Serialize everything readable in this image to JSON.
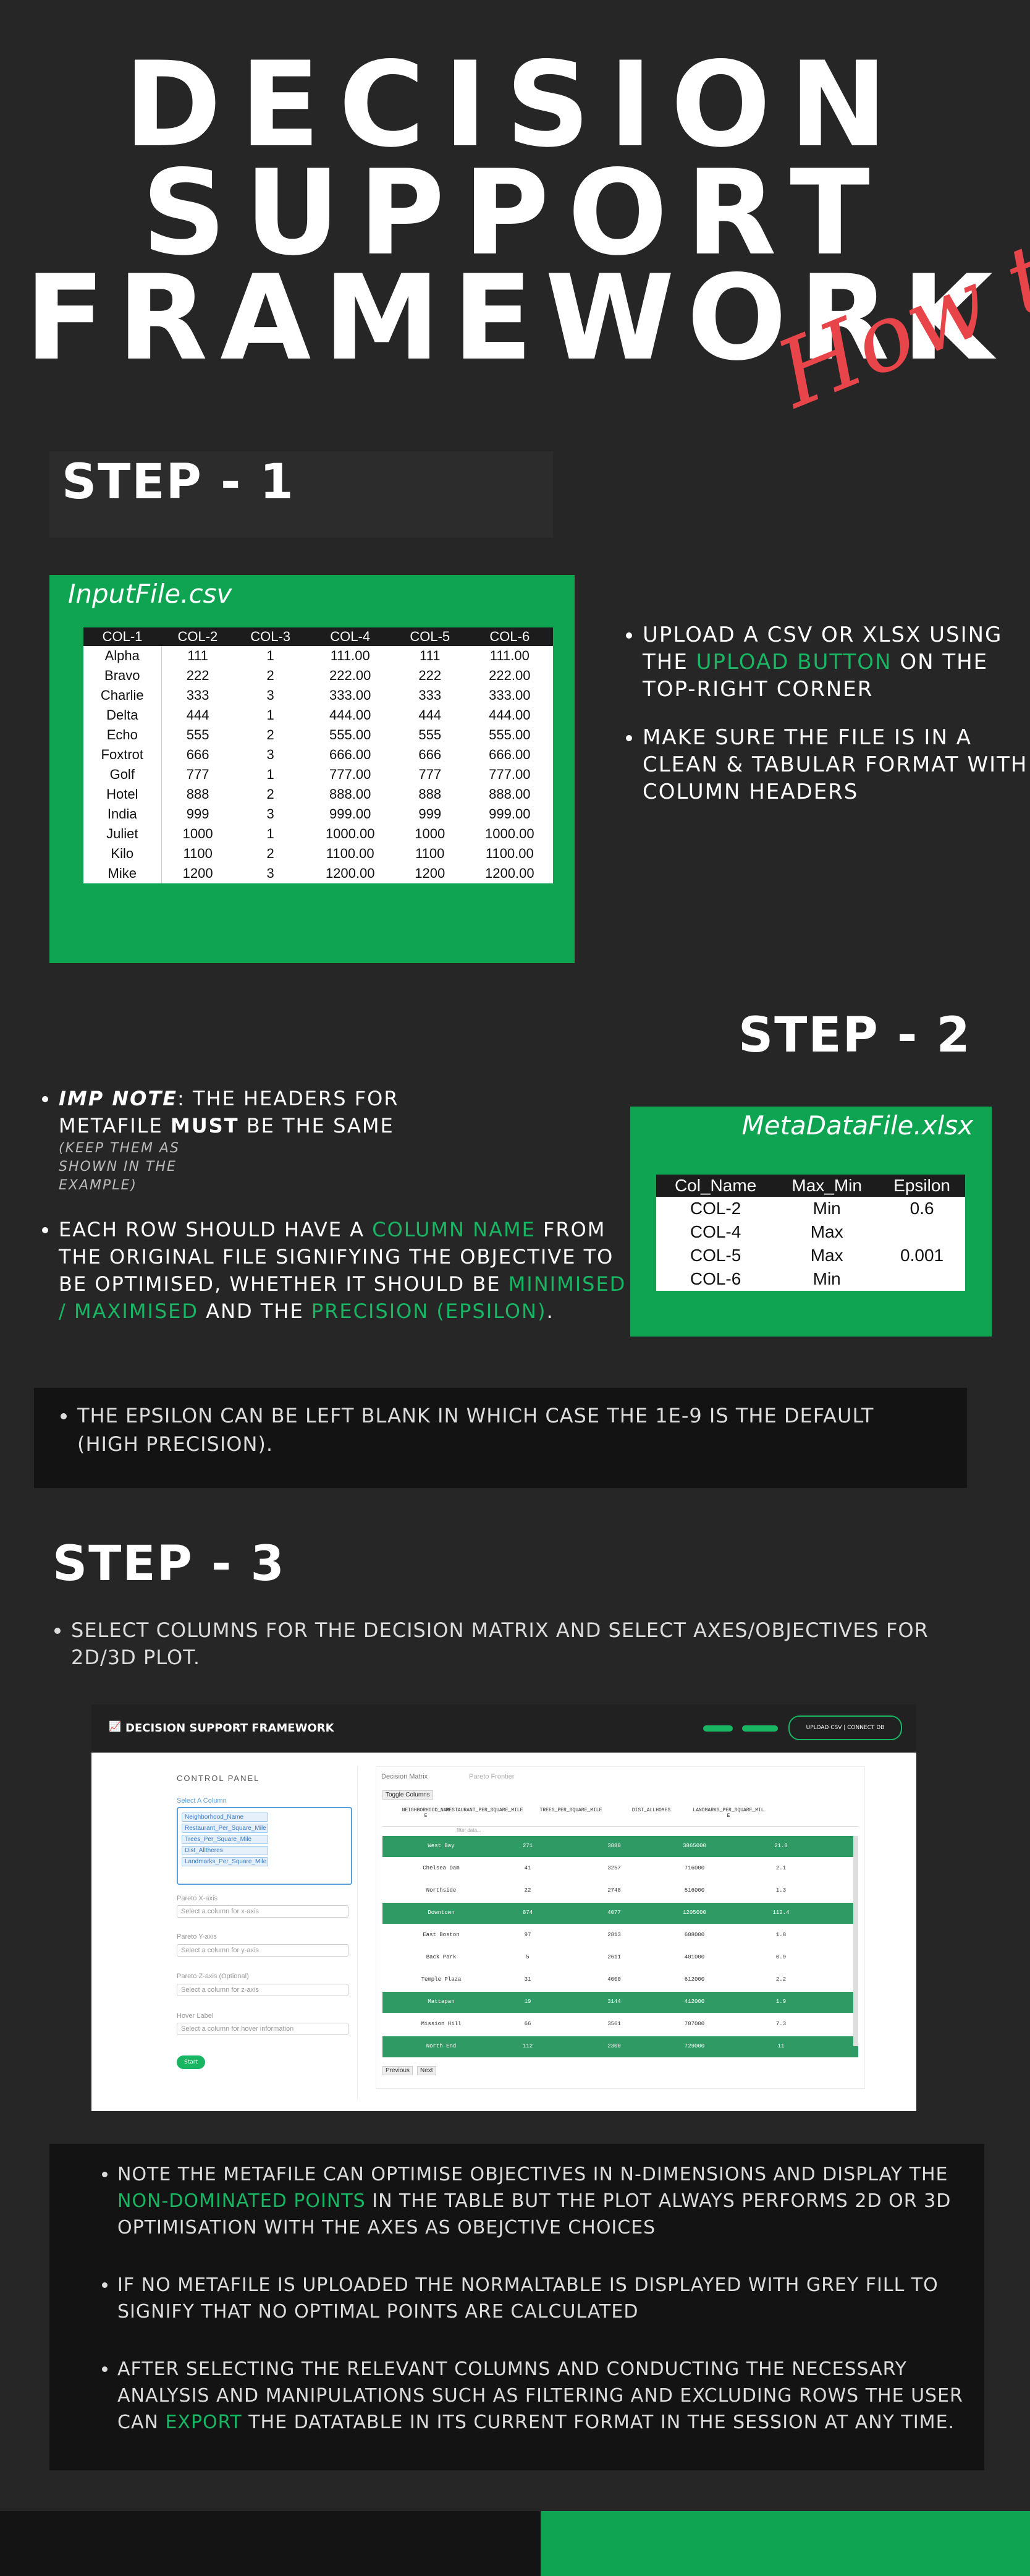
{
  "header": {
    "title_line1": "DECISION",
    "title_line2": "SUPPORT",
    "title_line3": "FRAMEWORK",
    "subtitle_script": "How to"
  },
  "step1": {
    "heading": "STEP - 1",
    "file_title": "InputFile.csv",
    "columns": [
      "COL-1",
      "COL-2",
      "COL-3",
      "COL-4",
      "COL-5",
      "COL-6"
    ],
    "rows": [
      [
        "Alpha",
        "111",
        "1",
        "111.00",
        "111",
        "111.00"
      ],
      [
        "Bravo",
        "222",
        "2",
        "222.00",
        "222",
        "222.00"
      ],
      [
        "Charlie",
        "333",
        "3",
        "333.00",
        "333",
        "333.00"
      ],
      [
        "Delta",
        "444",
        "1",
        "444.00",
        "444",
        "444.00"
      ],
      [
        "Echo",
        "555",
        "2",
        "555.00",
        "555",
        "555.00"
      ],
      [
        "Foxtrot",
        "666",
        "3",
        "666.00",
        "666",
        "666.00"
      ],
      [
        "Golf",
        "777",
        "1",
        "777.00",
        "777",
        "777.00"
      ],
      [
        "Hotel",
        "888",
        "2",
        "888.00",
        "888",
        "888.00"
      ],
      [
        "India",
        "999",
        "3",
        "999.00",
        "999",
        "999.00"
      ],
      [
        "Juliet",
        "1000",
        "1",
        "1000.00",
        "1000",
        "1000.00"
      ],
      [
        "Kilo",
        "1100",
        "2",
        "1100.00",
        "1100",
        "1100.00"
      ],
      [
        "Mike",
        "1200",
        "3",
        "1200.00",
        "1200",
        "1200.00"
      ]
    ],
    "bullet1_pre": "UPLOAD A CSV OR XLSX USING THE ",
    "bullet1_hl": "UPLOAD BUTTON",
    "bullet1_post": " ON THE TOP-RIGHT CORNER",
    "bullet2": "MAKE SURE THE FILE IS IN A CLEAN & TABULAR FORMAT WITH COLUMN HEADERS"
  },
  "step2": {
    "heading": "STEP - 2",
    "file_title": "MetaDataFile.xlsx",
    "columns": [
      "Col_Name",
      "Max_Min",
      "Epsilon"
    ],
    "rows": [
      [
        "COL-2",
        "Min",
        "0.6"
      ],
      [
        "COL-4",
        "Max",
        ""
      ],
      [
        "COL-5",
        "Max",
        "0.001"
      ],
      [
        "COL-6",
        "Min",
        ""
      ]
    ],
    "note_label": "IMP NOTE",
    "note_pre": ": THE HEADERS FOR METAFILE ",
    "note_bold": "MUST",
    "note_post": " BE THE SAME",
    "note_small": "(KEEP THEM AS SHOWN IN THE EXAMPLE)",
    "row_pre": "EACH ROW SHOULD HAVE A ",
    "row_hl1": "COLUMN NAME",
    "row_mid": " FROM THE ORIGINAL FILE SIGNIFYING THE OBJECTIVE TO BE OPTIMISED, WHETHER IT SHOULD BE ",
    "row_hl2": "MINIMISED / MAXIMISED",
    "row_mid2": " AND THE ",
    "row_hl3": "PRECISION (EPSILON)",
    "row_end": ".",
    "epsilon_note": "THE EPSILON CAN BE LEFT BLANK IN WHICH CASE THE 1E-9 IS THE DEFAULT (HIGH PRECISION)."
  },
  "step3": {
    "heading": "STEP - 3",
    "bullet": "SELECT COLUMNS FOR THE DECISION MATRIX AND SELECT AXES/OBJECTIVES FOR 2D/3D PLOT."
  },
  "app": {
    "title": "DECISION SUPPORT FRAMEWORK",
    "upload_button": "UPLOAD CSV | CONNECT DB",
    "control_panel": "CONTROL PANEL",
    "select_columns_label": "Select A Column",
    "selected_columns": [
      "Neighborhood_Name",
      "Restaurant_Per_Square_Mile",
      "Trees_Per_Square_Mile",
      "Dist_Alltheres",
      "Landmarks_Per_Square_Mile"
    ],
    "x_label": "Pareto X-axis",
    "x_placeholder": "Select a column for x-axis",
    "y_label": "Pareto Y-axis",
    "y_placeholder": "Select a column for y-axis",
    "z_label": "Pareto Z-axis (Optional)",
    "z_placeholder": "Select a column for z-axis",
    "hover_label": "Hover Label",
    "hover_placeholder": "Select a column for hover information",
    "submit": "Start",
    "tab1": "Decision Matrix",
    "tab2": "Pareto Frontier",
    "toggle": "Toggle Columns",
    "table_headers": [
      "NEIGHBORHOOD_NAME",
      "RESTAURANT_PER_SQUARE_MILE",
      "TREES_PER_SQUARE_MILE",
      "DIST_ALLHOMES",
      "LANDMARKS_PER_SQUARE_MILE"
    ],
    "filter_placeholder": "filter data...",
    "table_rows": [
      {
        "name": "West Bay",
        "a": "271",
        "b": "3880",
        "c": "3865000",
        "d": "21.8",
        "green": true
      },
      {
        "name": "Chelsea Dam",
        "a": "41",
        "b": "3257",
        "c": "716000",
        "d": "2.1",
        "green": false
      },
      {
        "name": "Northside",
        "a": "22",
        "b": "2748",
        "c": "516000",
        "d": "1.3",
        "green": false
      },
      {
        "name": "Downtown",
        "a": "874",
        "b": "4077",
        "c": "1205000",
        "d": "112.4",
        "green": true
      },
      {
        "name": "East Boston",
        "a": "97",
        "b": "2813",
        "c": "608000",
        "d": "1.8",
        "green": false
      },
      {
        "name": "Back Park",
        "a": "5",
        "b": "2611",
        "c": "401000",
        "d": "0.9",
        "green": false
      },
      {
        "name": "Temple Plaza",
        "a": "31",
        "b": "4000",
        "c": "612000",
        "d": "2.2",
        "green": false
      },
      {
        "name": "Mattapan",
        "a": "19",
        "b": "3144",
        "c": "412000",
        "d": "1.9",
        "green": true
      },
      {
        "name": "Mission Hill",
        "a": "66",
        "b": "3561",
        "c": "707000",
        "d": "7.3",
        "green": false
      },
      {
        "name": "North End",
        "a": "112",
        "b": "2300",
        "c": "729000",
        "d": "11",
        "green": true
      }
    ],
    "prev": "Previous",
    "next": "Next"
  },
  "notes": {
    "n1_pre": "NOTE THE METAFILE CAN OPTIMISE OBJECTIVES IN N-DIMENSIONS AND DISPLAY THE ",
    "n1_hl": "NON-DOMINATED POINTS",
    "n1_post": " IN THE TABLE BUT THE PLOT ALWAYS PERFORMS 2D OR 3D OPTIMISATION WITH THE AXES AS OBEJCTIVE CHOICES",
    "n2": "IF NO METAFILE IS UPLOADED THE NORMALTABLE IS DISPLAYED WITH GREY FILL TO SIGNIFY THAT NO OPTIMAL POINTS ARE CALCULATED",
    "n3_pre": "AFTER SELECTING THE RELEVANT COLUMNS AND CONDUCTING THE NECESSARY ANALYSIS AND MANIPULATIONS SUCH AS FILTERING AND EXCLUDING ROWS THE USER CAN ",
    "n3_hl": "EXPORT",
    "n3_post": " THE DATATABLE IN ITS CURRENT FORMAT IN THE SESSION AT ANY TIME."
  },
  "colors": {
    "accent_green": "#0ea451",
    "script_red": "#e8454b",
    "background": "#262626"
  }
}
